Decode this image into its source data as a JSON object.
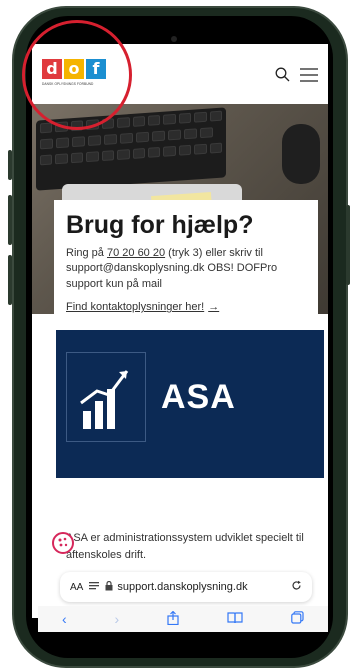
{
  "logo": {
    "letters": [
      "d",
      "o",
      "f"
    ],
    "letter_colors": [
      "#e03a3e",
      "#f5b400",
      "#1b8fd1"
    ],
    "subtitle": "DANSK OPLYSNINGS FORBUND"
  },
  "header": {
    "search_icon": "search-icon",
    "menu_icon": "hamburger-menu-icon"
  },
  "help_card": {
    "title": "Brug for hjælp?",
    "text_before_phone": "Ring på ",
    "phone": "70 20 60 20",
    "text_after_phone": " (tryk 3) eller skriv til support@danskoplysning.dk OBS! DOFPro support kun på mail",
    "link_label": "Find kontaktoplysninger her!",
    "link_arrow": "→"
  },
  "asa_card": {
    "label": "ASA",
    "icon": "growth-chart-icon",
    "background": "#0c2a55"
  },
  "asa_description": "ASA er administrationssystem udviklet specielt til aftenskoles drift.",
  "browser": {
    "aa_label": "AA",
    "url": "support.danskoplysning.dk",
    "toolbar_icons": [
      "back-icon",
      "forward-icon",
      "share-icon",
      "bookmarks-icon",
      "tabs-icon"
    ]
  },
  "colors": {
    "annotation_circle": "#d6202f",
    "phone_body": "#1b2a1f",
    "link_blue": "#3478f6"
  }
}
